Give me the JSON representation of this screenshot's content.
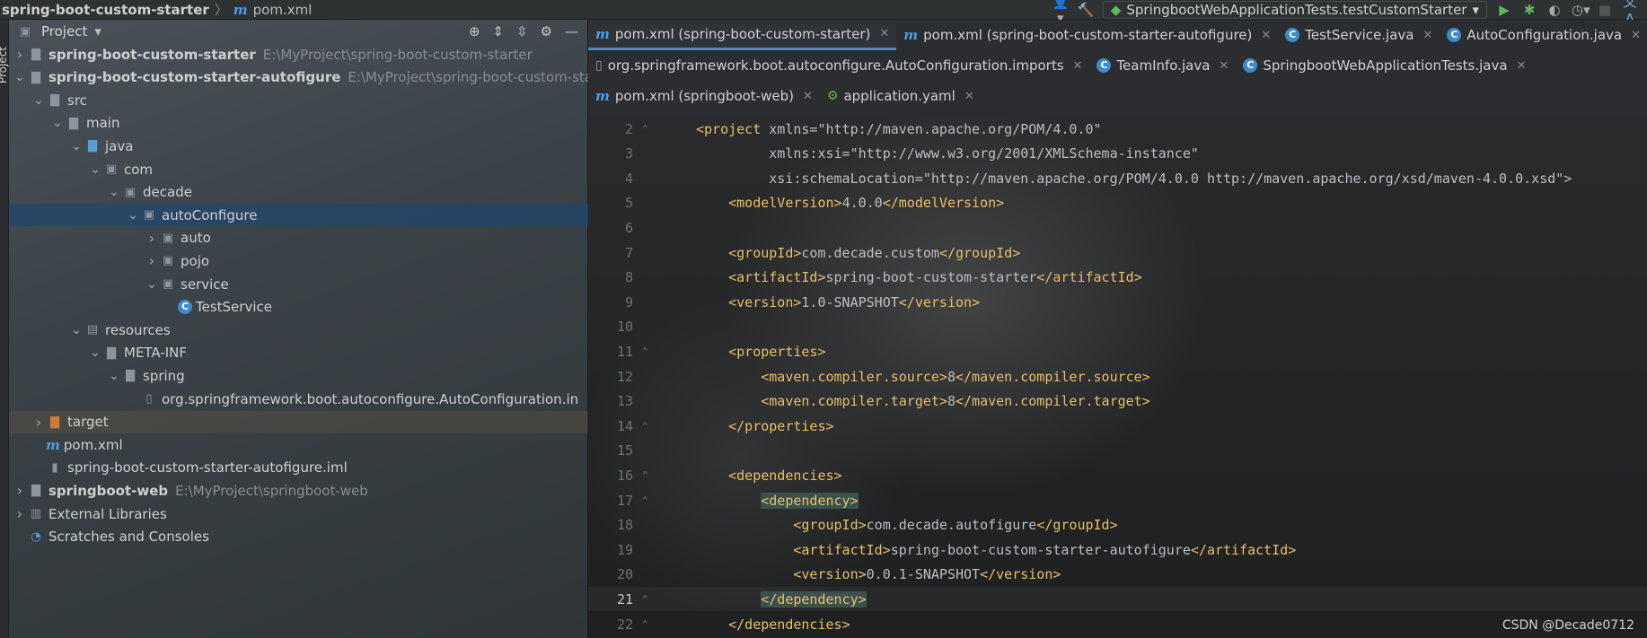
{
  "breadcrumb": {
    "project": "spring-boot-custom-starter",
    "file": "pom.xml"
  },
  "run_config": {
    "label": "SpringbootWebApplicationTests.testCustomStarter"
  },
  "left_stripe_label": "Project",
  "project_panel": {
    "title": "Project",
    "tree": [
      {
        "label": "spring-boot-custom-starter",
        "path": "E:\\MyProject\\spring-boot-custom-starter",
        "depth": 0,
        "arrow": "right",
        "icon": "module",
        "bold": true
      },
      {
        "label": "spring-boot-custom-starter-autofigure",
        "path": "E:\\MyProject\\spring-boot-custom-start",
        "depth": 0,
        "arrow": "down",
        "icon": "module",
        "bold": true
      },
      {
        "label": "src",
        "path": "",
        "depth": 1,
        "arrow": "down",
        "icon": "folder"
      },
      {
        "label": "main",
        "path": "",
        "depth": 2,
        "arrow": "down",
        "icon": "folder"
      },
      {
        "label": "java",
        "path": "",
        "depth": 3,
        "arrow": "down",
        "icon": "folder-blue"
      },
      {
        "label": "com",
        "path": "",
        "depth": 4,
        "arrow": "down",
        "icon": "package"
      },
      {
        "label": "decade",
        "path": "",
        "depth": 5,
        "arrow": "down",
        "icon": "package"
      },
      {
        "label": "autoConfigure",
        "path": "",
        "depth": 6,
        "arrow": "down",
        "icon": "package",
        "selected": true
      },
      {
        "label": "auto",
        "path": "",
        "depth": 7,
        "arrow": "right",
        "icon": "package"
      },
      {
        "label": "pojo",
        "path": "",
        "depth": 7,
        "arrow": "right",
        "icon": "package"
      },
      {
        "label": "service",
        "path": "",
        "depth": 7,
        "arrow": "down",
        "icon": "package"
      },
      {
        "label": "TestService",
        "path": "",
        "depth": 8,
        "arrow": "",
        "icon": "class"
      },
      {
        "label": "resources",
        "path": "",
        "depth": 3,
        "arrow": "down",
        "icon": "resources"
      },
      {
        "label": "META-INF",
        "path": "",
        "depth": 4,
        "arrow": "down",
        "icon": "folder"
      },
      {
        "label": "spring",
        "path": "",
        "depth": 5,
        "arrow": "down",
        "icon": "folder"
      },
      {
        "label": "org.springframework.boot.autoconfigure.AutoConfiguration.in",
        "path": "",
        "depth": 6,
        "arrow": "",
        "icon": "file"
      },
      {
        "label": "target",
        "path": "",
        "depth": 1,
        "arrow": "right",
        "icon": "folder-orange",
        "target": true
      },
      {
        "label": "pom.xml",
        "path": "",
        "depth": 1,
        "arrow": "",
        "icon": "maven"
      },
      {
        "label": "spring-boot-custom-starter-autofigure.iml",
        "path": "",
        "depth": 1,
        "arrow": "",
        "icon": "iml"
      },
      {
        "label": "springboot-web",
        "path": "E:\\MyProject\\springboot-web",
        "depth": 0,
        "arrow": "right",
        "icon": "module",
        "bold": true
      },
      {
        "label": "External Libraries",
        "path": "",
        "depth": 0,
        "arrow": "right",
        "icon": "libraries"
      },
      {
        "label": "Scratches and Consoles",
        "path": "",
        "depth": 0,
        "arrow": "",
        "icon": "scratches"
      }
    ]
  },
  "editor_tabs": {
    "row1": [
      {
        "label": "pom.xml (spring-boot-custom-starter)",
        "icon": "maven",
        "active": true
      },
      {
        "label": "pom.xml (spring-boot-custom-starter-autofigure)",
        "icon": "maven"
      },
      {
        "label": "TestService.java",
        "icon": "class"
      },
      {
        "label": "AutoConfiguration.java",
        "icon": "class"
      }
    ],
    "row2": [
      {
        "label": "org.springframework.boot.autoconfigure.AutoConfiguration.imports",
        "icon": "file"
      },
      {
        "label": "TeamInfo.java",
        "icon": "class"
      },
      {
        "label": "SpringbootWebApplicationTests.java",
        "icon": "class"
      }
    ],
    "row3": [
      {
        "label": "pom.xml (springboot-web)",
        "icon": "maven"
      },
      {
        "label": "application.yaml",
        "icon": "yaml"
      }
    ]
  },
  "code_lines": [
    {
      "n": "2",
      "text": "<project xmlns=\"http://maven.apache.org/POM/4.0.0\""
    },
    {
      "n": "3",
      "text": "         xmlns:xsi=\"http://www.w3.org/2001/XMLSchema-instance\""
    },
    {
      "n": "4",
      "text": "         xsi:schemaLocation=\"http://maven.apache.org/POM/4.0.0 http://maven.apache.org/xsd/maven-4.0.0.xsd\">"
    },
    {
      "n": "5",
      "text": "    <modelVersion>4.0.0</modelVersion>"
    },
    {
      "n": "6",
      "text": ""
    },
    {
      "n": "7",
      "text": "    <groupId>com.decade.custom</groupId>"
    },
    {
      "n": "8",
      "text": "    <artifactId>spring-boot-custom-starter</artifactId>"
    },
    {
      "n": "9",
      "text": "    <version>1.0-SNAPSHOT</version>"
    },
    {
      "n": "10",
      "text": ""
    },
    {
      "n": "11",
      "text": "    <properties>"
    },
    {
      "n": "12",
      "text": "        <maven.compiler.source>8</maven.compiler.source>"
    },
    {
      "n": "13",
      "text": "        <maven.compiler.target>8</maven.compiler.target>"
    },
    {
      "n": "14",
      "text": "    </properties>"
    },
    {
      "n": "15",
      "text": ""
    },
    {
      "n": "16",
      "text": "    <dependencies>"
    },
    {
      "n": "17",
      "text": "        <dependency>"
    },
    {
      "n": "18",
      "text": "            <groupId>com.decade.autofigure</groupId>"
    },
    {
      "n": "19",
      "text": "            <artifactId>spring-boot-custom-starter-autofigure</artifactId>"
    },
    {
      "n": "20",
      "text": "            <version>0.0.1-SNAPSHOT</version>"
    },
    {
      "n": "21",
      "text": "        </dependency>"
    },
    {
      "n": "22",
      "text": "    </dependencies>"
    }
  ],
  "current_line": "21",
  "watermark": "CSDN @Decade0712"
}
